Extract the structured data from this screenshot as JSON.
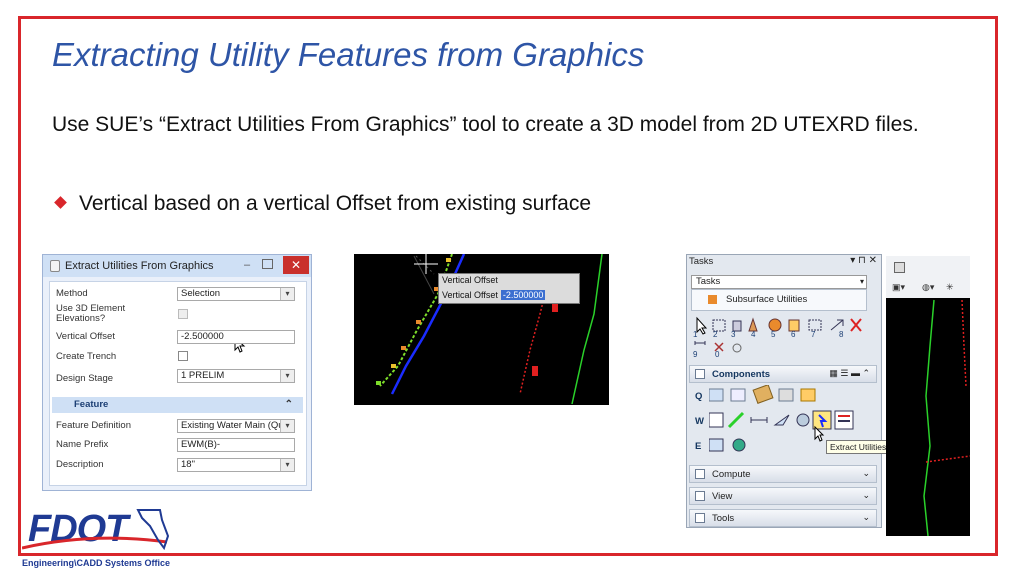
{
  "slide": {
    "title": "Extracting Utility Features from Graphics",
    "body": "Use SUE’s “Extract Utilities From Graphics” tool to create a 3D model from 2D UTEXRD files.",
    "bullet": "Vertical based on a vertical Offset from existing surface"
  },
  "dialog": {
    "title": "Extract Utilities From Graphics",
    "close": "✕",
    "min": "–",
    "fields": {
      "method_label": "Method",
      "method_value": "Selection",
      "use3d_label": "Use 3D Element Elevations?",
      "voffset_label": "Vertical Offset",
      "voffset_value": "-2.500000",
      "trench_label": "Create Trench",
      "stage_label": "Design Stage",
      "stage_value": "1 PRELIM"
    },
    "section": "Feature",
    "feature": {
      "def_label": "Feature Definition",
      "def_value": "Existing Water Main (Qualit",
      "prefix_label": "Name Prefix",
      "prefix_value": "EWM(B)-",
      "desc_label": "Description",
      "desc_value": "18\""
    }
  },
  "cad": {
    "panel_title": "Vertical Offset",
    "panel_label": "Vertical Offset",
    "panel_value": "-2.500000",
    "colors": {
      "dots_green": "#7ddc2a",
      "dots_orange": "#e98a2c",
      "line_blue": "#1a2cff",
      "line_red": "#e02020",
      "line_green": "#2ad12a"
    }
  },
  "tasks": {
    "header": "Tasks",
    "header_controls": "▾ ⊓ ✕",
    "combo": "Tasks",
    "subsurface": "Subsurface Utilities",
    "toolbar_row1": [
      "1",
      "2",
      "3",
      "4",
      "5",
      "6",
      "7",
      "8"
    ],
    "toolbar_row2": [
      "9",
      "0"
    ],
    "components": "Components",
    "row_letters": [
      "Q",
      "W",
      "E"
    ],
    "tooltip": "Extract Utilities From Graphics",
    "groups": [
      "Compute",
      "View",
      "Tools"
    ]
  },
  "logo": {
    "wordmark": "FDOT",
    "subtitle": "Engineering\\CADD Systems Office"
  }
}
